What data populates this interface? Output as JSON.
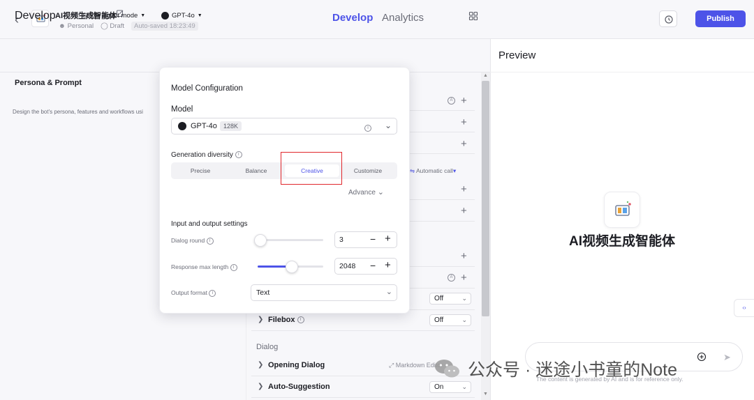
{
  "header": {
    "bot_name": "AI视频生成智能体",
    "owner": "Personal",
    "status": "Draft",
    "autosave": "Auto-saved 18:23:49",
    "tabs": [
      "Develop",
      "Analytics"
    ],
    "publish_label": "Publish"
  },
  "develop": {
    "title": "Develop",
    "mode": "Single agent mode",
    "model": "GPT-4o"
  },
  "left": {
    "section_title": "Persona & Prompt",
    "description": "Design the bot's persona, features and workflows usi"
  },
  "mid": {
    "automatic_call": "Automatic call",
    "filebox_label": "Filebox",
    "filebox_value": "Off",
    "row_select_value": "Off",
    "dialog_section": "Dialog",
    "opening_dialog": "Opening Dialog",
    "markdown_editor": "Markdown Editor",
    "auto_suggestion": "Auto-Suggestion",
    "auto_suggestion_value": "On"
  },
  "model_config": {
    "title": "Model Configuration",
    "model_label": "Model",
    "model_name": "GPT-4o",
    "context": "128K",
    "generation_diversity": "Generation diversity",
    "diversity_options": [
      "Precise",
      "Balance",
      "Creative",
      "Customize"
    ],
    "selected_option": "Creative",
    "advance": "Advance",
    "io_title": "Input and output settings",
    "dialog_round_label": "Dialog round",
    "dialog_round_value": "3",
    "dialog_round_level": 0.02,
    "response_max_label": "Response max length",
    "response_max_value": "2048",
    "response_max_level": 0.5,
    "output_format_label": "Output format",
    "output_format_value": "Text"
  },
  "preview": {
    "title": "Preview",
    "bot_name": "AI视频生成智能体",
    "disclaimer": "The content is generated by AI and is for reference only."
  },
  "watermark": {
    "text": "公众号 · 迷途小书童的Note"
  },
  "colors": {
    "accent": "#4d53e8",
    "highlight_box": "#e0262b"
  }
}
